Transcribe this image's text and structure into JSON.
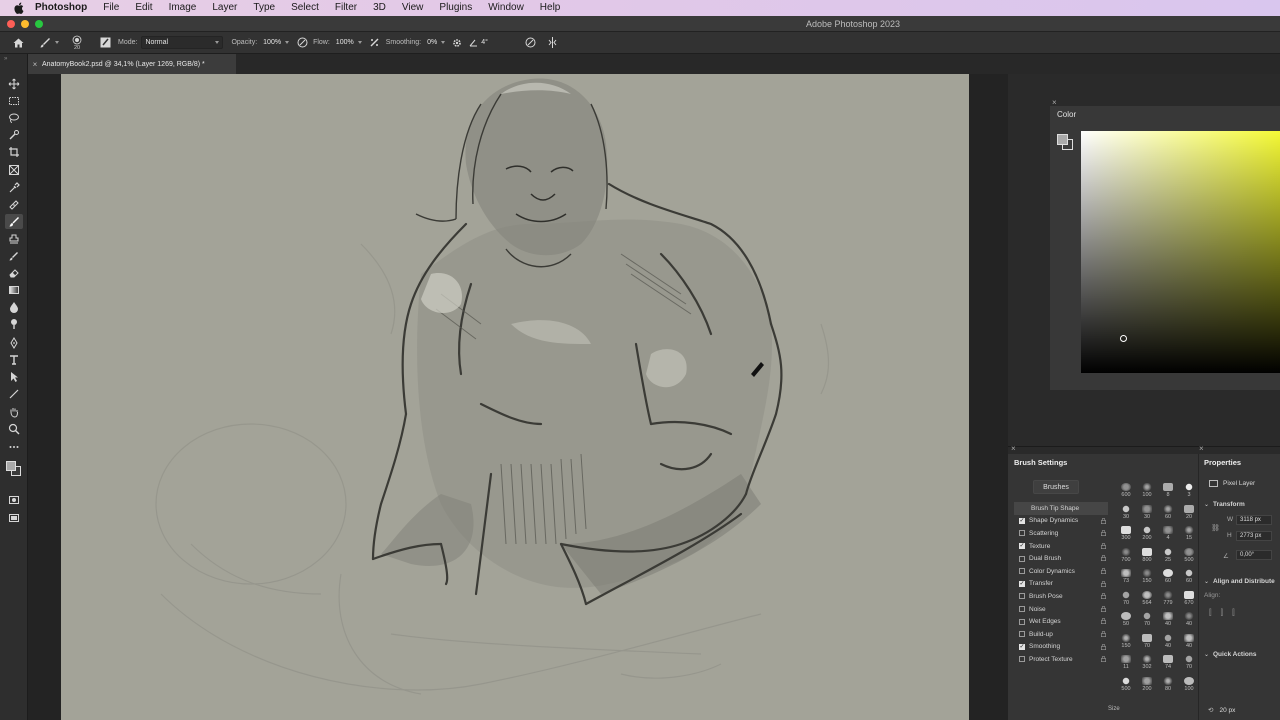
{
  "menubar": {
    "app_name": "Photoshop",
    "items": [
      "File",
      "Edit",
      "Image",
      "Layer",
      "Type",
      "Select",
      "Filter",
      "3D",
      "View",
      "Plugins",
      "Window",
      "Help"
    ]
  },
  "window": {
    "title": "Adobe Photoshop 2023"
  },
  "options_bar": {
    "brush_size": "20",
    "mode_label": "Mode:",
    "mode_value": "Normal",
    "opacity_label": "Opacity:",
    "opacity_value": "100%",
    "flow_label": "Flow:",
    "flow_value": "100%",
    "smoothing_label": "Smoothing:",
    "smoothing_value": "0%",
    "angle_value": "4°"
  },
  "document": {
    "tab_title": "AnatomyBook2.psd @ 34,1% (Layer 1269, RGB/8) *"
  },
  "color_panel": {
    "title": "Color",
    "hue_color": "#f4f935"
  },
  "brush_settings": {
    "title": "Brush Settings",
    "brushes_button": "Brushes",
    "tip_shape": "Brush Tip Shape",
    "options": [
      {
        "label": "Shape Dynamics",
        "checked": true
      },
      {
        "label": "Scattering",
        "checked": false
      },
      {
        "label": "Texture",
        "checked": true
      },
      {
        "label": "Dual Brush",
        "checked": false
      },
      {
        "label": "Color Dynamics",
        "checked": false
      },
      {
        "label": "Transfer",
        "checked": true
      },
      {
        "label": "Brush Pose",
        "checked": false
      },
      {
        "label": "Noise",
        "checked": false
      },
      {
        "label": "Wet Edges",
        "checked": false
      },
      {
        "label": "Build-up",
        "checked": false
      },
      {
        "label": "Smoothing",
        "checked": true
      },
      {
        "label": "Protect Texture",
        "checked": false
      }
    ],
    "grid_sizes": [
      "600",
      "100",
      "8",
      "3",
      "30",
      "30",
      "60",
      "20",
      "300",
      "200",
      "4",
      "15",
      "700",
      "800",
      "25",
      "500",
      "73",
      "150",
      "60",
      "60",
      "70",
      "564",
      "779",
      "670",
      "50",
      "70",
      "40",
      "40",
      "150",
      "70",
      "40",
      "40",
      "11",
      "302",
      "74",
      "70",
      "500",
      "200",
      "80",
      "100"
    ],
    "size_label": "Size",
    "size_value": "20 px"
  },
  "properties": {
    "title": "Properties",
    "layer_type": "Pixel Layer",
    "transform_label": "Transform",
    "w_label": "W",
    "w_value": "3118 px",
    "h_label": "H",
    "h_value": "2773 px",
    "angle_value": "0,00°",
    "align_label": "Align and Distribute",
    "align_sub": "Align:",
    "quick_actions": "Quick Actions"
  },
  "colors": {
    "canvas_bg": "#a3a398",
    "sketch_stroke": "#3b3b36"
  },
  "icons": {
    "tools": [
      "move-icon",
      "marquee-icon",
      "lasso-icon",
      "quick-select-icon",
      "crop-icon",
      "frame-icon",
      "eyedropper-icon",
      "healing-icon",
      "brush-icon",
      "stamp-icon",
      "history-brush-icon",
      "eraser-icon",
      "gradient-icon",
      "blur-icon",
      "dodge-icon",
      "pen-icon",
      "type-icon",
      "path-select-icon",
      "line-icon",
      "hand-icon",
      "zoom-icon",
      "more-tools-icon"
    ]
  }
}
